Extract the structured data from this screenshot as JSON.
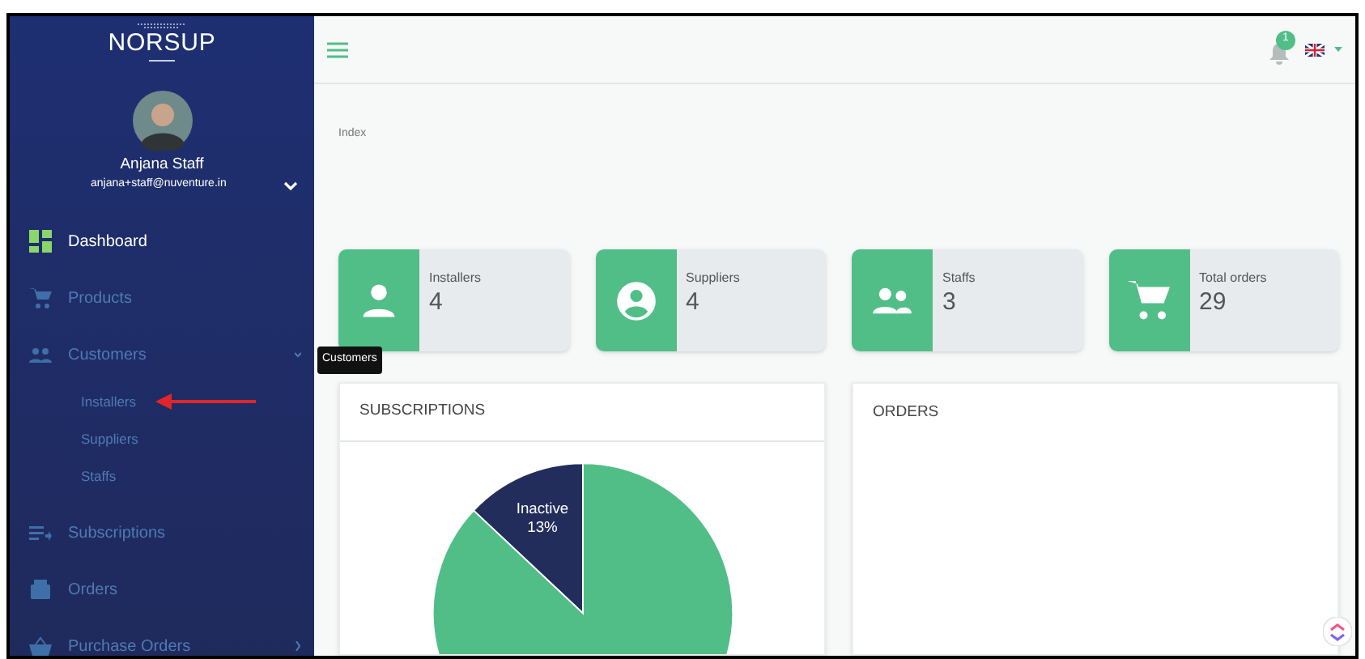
{
  "sidebar": {
    "logo": "NORSUP",
    "user": {
      "name": "Anjana Staff",
      "email": "anjana+staff@nuventure.in"
    },
    "items": [
      {
        "label": "Dashboard",
        "selected": true
      },
      {
        "label": "Products",
        "selected": false
      },
      {
        "label": "Customers",
        "selected": false,
        "expanded": true,
        "children": [
          {
            "label": "Installers"
          },
          {
            "label": "Suppliers"
          },
          {
            "label": "Staffs"
          }
        ]
      },
      {
        "label": "Subscriptions",
        "selected": false
      },
      {
        "label": "Orders",
        "selected": false
      },
      {
        "label": "Purchase Orders",
        "selected": false,
        "expanded": false
      }
    ]
  },
  "tooltip": "Customers",
  "topbar": {
    "notifications": "1"
  },
  "breadcrumb": "Index",
  "stats": [
    {
      "label": "Installers",
      "value": "4"
    },
    {
      "label": "Suppliers",
      "value": "4"
    },
    {
      "label": "Staffs",
      "value": "3"
    },
    {
      "label": "Total orders",
      "value": "29"
    }
  ],
  "panels": [
    {
      "title": "SUBSCRIPTIONS",
      "chart_data": {
        "type": "pie",
        "categories": [
          "Inactive",
          null
        ],
        "values": [
          13,
          87
        ],
        "colors": [
          "#222d5c",
          "#52be87"
        ],
        "value_labels": [
          "13%",
          null
        ]
      }
    },
    {
      "title": "ORDERS"
    }
  ]
}
